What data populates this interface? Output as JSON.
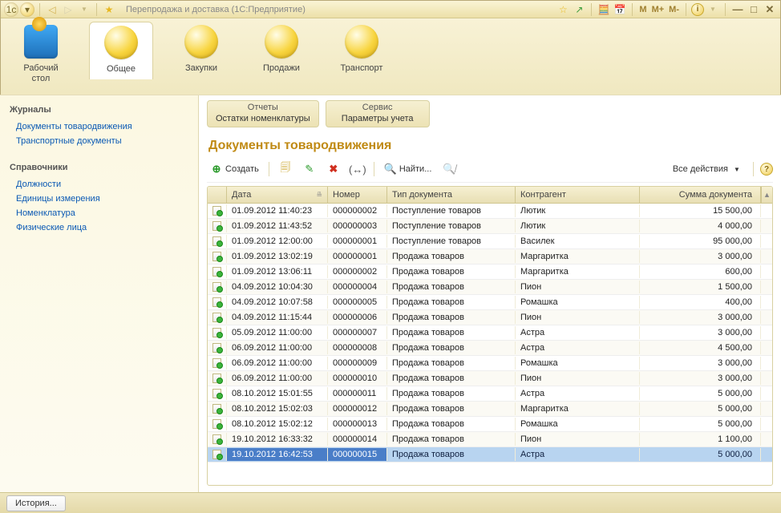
{
  "titlebar": {
    "title": "Перепродажа и доставка  (1С:Предприятие)",
    "m_buttons": [
      "M",
      "M+",
      "M-"
    ]
  },
  "sections": [
    {
      "key": "desk",
      "label": "Рабочий\nстол",
      "active": false
    },
    {
      "key": "common",
      "label": "Общее",
      "active": true
    },
    {
      "key": "buy",
      "label": "Закупки",
      "active": false
    },
    {
      "key": "sell",
      "label": "Продажи",
      "active": false
    },
    {
      "key": "trans",
      "label": "Транспорт",
      "active": false
    }
  ],
  "sidebar": {
    "groups": [
      {
        "title": "Журналы",
        "links": [
          "Документы товародвижения",
          "Транспортные документы"
        ]
      },
      {
        "title": "Справочники",
        "links": [
          "Должности",
          "Единицы измерения",
          "Номенклатура",
          "Физические лица"
        ]
      }
    ]
  },
  "action_panels": [
    {
      "title": "Отчеты",
      "action": "Остатки номенклатуры"
    },
    {
      "title": "Сервис",
      "action": "Параметры учета"
    }
  ],
  "main_title": "Документы товародвижения",
  "toolbar": {
    "create": "Создать",
    "find": "Найти...",
    "all_actions": "Все действия"
  },
  "columns": {
    "date": "Дата",
    "num": "Номер",
    "type": "Тип документа",
    "agent": "Контрагент",
    "sum": "Сумма документа"
  },
  "rows": [
    {
      "date": "01.09.2012 11:40:23",
      "num": "000000002",
      "type": "Поступление товаров",
      "agent": "Лютик",
      "sum": "15 500,00",
      "sel": false
    },
    {
      "date": "01.09.2012 11:43:52",
      "num": "000000003",
      "type": "Поступление товаров",
      "agent": "Лютик",
      "sum": "4 000,00",
      "sel": false
    },
    {
      "date": "01.09.2012 12:00:00",
      "num": "000000001",
      "type": "Поступление товаров",
      "agent": "Василек",
      "sum": "95 000,00",
      "sel": false
    },
    {
      "date": "01.09.2012 13:02:19",
      "num": "000000001",
      "type": "Продажа товаров",
      "agent": "Маргаритка",
      "sum": "3 000,00",
      "sel": false
    },
    {
      "date": "01.09.2012 13:06:11",
      "num": "000000002",
      "type": "Продажа товаров",
      "agent": "Маргаритка",
      "sum": "600,00",
      "sel": false
    },
    {
      "date": "04.09.2012 10:04:30",
      "num": "000000004",
      "type": "Продажа товаров",
      "agent": "Пион",
      "sum": "1 500,00",
      "sel": false
    },
    {
      "date": "04.09.2012 10:07:58",
      "num": "000000005",
      "type": "Продажа товаров",
      "agent": "Ромашка",
      "sum": "400,00",
      "sel": false
    },
    {
      "date": "04.09.2012 11:15:44",
      "num": "000000006",
      "type": "Продажа товаров",
      "agent": "Пион",
      "sum": "3 000,00",
      "sel": false
    },
    {
      "date": "05.09.2012 11:00:00",
      "num": "000000007",
      "type": "Продажа товаров",
      "agent": "Астра",
      "sum": "3 000,00",
      "sel": false
    },
    {
      "date": "06.09.2012 11:00:00",
      "num": "000000008",
      "type": "Продажа товаров",
      "agent": "Астра",
      "sum": "4 500,00",
      "sel": false
    },
    {
      "date": "06.09.2012 11:00:00",
      "num": "000000009",
      "type": "Продажа товаров",
      "agent": "Ромашка",
      "sum": "3 000,00",
      "sel": false
    },
    {
      "date": "06.09.2012 11:00:00",
      "num": "000000010",
      "type": "Продажа товаров",
      "agent": "Пион",
      "sum": "3 000,00",
      "sel": false
    },
    {
      "date": "08.10.2012 15:01:55",
      "num": "000000011",
      "type": "Продажа товаров",
      "agent": "Астра",
      "sum": "5 000,00",
      "sel": false
    },
    {
      "date": "08.10.2012 15:02:03",
      "num": "000000012",
      "type": "Продажа товаров",
      "agent": "Маргаритка",
      "sum": "5 000,00",
      "sel": false
    },
    {
      "date": "08.10.2012 15:02:12",
      "num": "000000013",
      "type": "Продажа товаров",
      "agent": "Ромашка",
      "sum": "5 000,00",
      "sel": false
    },
    {
      "date": "19.10.2012 16:33:32",
      "num": "000000014",
      "type": "Продажа товаров",
      "agent": "Пион",
      "sum": "1 100,00",
      "sel": false
    },
    {
      "date": "19.10.2012 16:42:53",
      "num": "000000015",
      "type": "Продажа товаров",
      "agent": "Астра",
      "sum": "5 000,00",
      "sel": true
    }
  ],
  "statusbar": {
    "history": "История..."
  }
}
